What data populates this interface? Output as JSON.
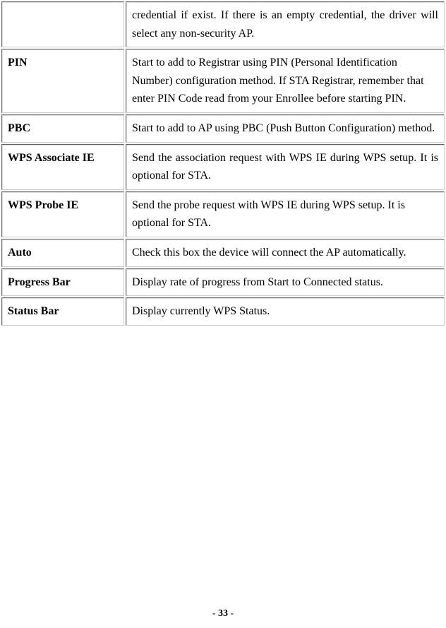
{
  "rows": [
    {
      "term": "",
      "desc": "credential if exist. If there is an empty credential, the driver will select any non-security AP.",
      "justify": true
    },
    {
      "term": "PIN",
      "desc": "Start to add to Registrar using PIN (Personal Identification Number) configuration method. If STA Registrar, remember that enter PIN Code read from your Enrollee before starting PIN.",
      "justify": false
    },
    {
      "term": "PBC",
      "desc": "Start to add to AP using PBC (Push Button Configuration) method.",
      "justify": false
    },
    {
      "term": "WPS Associate IE",
      "desc": "Send the association request with WPS IE during WPS setup. It is optional for STA.",
      "justify": true
    },
    {
      "term": "WPS Probe IE",
      "desc": "Send the probe request with WPS IE during WPS setup. It is optional for STA.",
      "justify": false
    },
    {
      "term": "Auto",
      "desc": "Check this box the device will connect the AP automatically.",
      "justify": true
    },
    {
      "term": "Progress Bar",
      "desc": "Display rate of progress from Start to Connected status.",
      "justify": false
    },
    {
      "term": "Status Bar",
      "desc": "Display currently WPS Status.",
      "justify": false
    }
  ],
  "page_number_prefix": "- ",
  "page_number": "33",
  "page_number_suffix": " -"
}
